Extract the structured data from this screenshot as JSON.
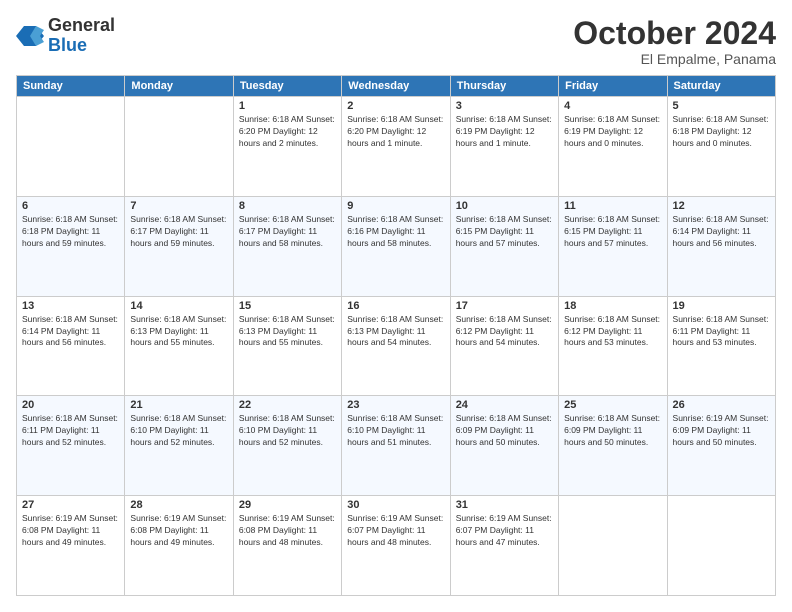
{
  "logo": {
    "general": "General",
    "blue": "Blue"
  },
  "header": {
    "month": "October 2024",
    "location": "El Empalme, Panama"
  },
  "days_of_week": [
    "Sunday",
    "Monday",
    "Tuesday",
    "Wednesday",
    "Thursday",
    "Friday",
    "Saturday"
  ],
  "weeks": [
    [
      {
        "day": "",
        "info": ""
      },
      {
        "day": "",
        "info": ""
      },
      {
        "day": "1",
        "info": "Sunrise: 6:18 AM\nSunset: 6:20 PM\nDaylight: 12 hours\nand 2 minutes."
      },
      {
        "day": "2",
        "info": "Sunrise: 6:18 AM\nSunset: 6:20 PM\nDaylight: 12 hours\nand 1 minute."
      },
      {
        "day": "3",
        "info": "Sunrise: 6:18 AM\nSunset: 6:19 PM\nDaylight: 12 hours\nand 1 minute."
      },
      {
        "day": "4",
        "info": "Sunrise: 6:18 AM\nSunset: 6:19 PM\nDaylight: 12 hours\nand 0 minutes."
      },
      {
        "day": "5",
        "info": "Sunrise: 6:18 AM\nSunset: 6:18 PM\nDaylight: 12 hours\nand 0 minutes."
      }
    ],
    [
      {
        "day": "6",
        "info": "Sunrise: 6:18 AM\nSunset: 6:18 PM\nDaylight: 11 hours\nand 59 minutes."
      },
      {
        "day": "7",
        "info": "Sunrise: 6:18 AM\nSunset: 6:17 PM\nDaylight: 11 hours\nand 59 minutes."
      },
      {
        "day": "8",
        "info": "Sunrise: 6:18 AM\nSunset: 6:17 PM\nDaylight: 11 hours\nand 58 minutes."
      },
      {
        "day": "9",
        "info": "Sunrise: 6:18 AM\nSunset: 6:16 PM\nDaylight: 11 hours\nand 58 minutes."
      },
      {
        "day": "10",
        "info": "Sunrise: 6:18 AM\nSunset: 6:15 PM\nDaylight: 11 hours\nand 57 minutes."
      },
      {
        "day": "11",
        "info": "Sunrise: 6:18 AM\nSunset: 6:15 PM\nDaylight: 11 hours\nand 57 minutes."
      },
      {
        "day": "12",
        "info": "Sunrise: 6:18 AM\nSunset: 6:14 PM\nDaylight: 11 hours\nand 56 minutes."
      }
    ],
    [
      {
        "day": "13",
        "info": "Sunrise: 6:18 AM\nSunset: 6:14 PM\nDaylight: 11 hours\nand 56 minutes."
      },
      {
        "day": "14",
        "info": "Sunrise: 6:18 AM\nSunset: 6:13 PM\nDaylight: 11 hours\nand 55 minutes."
      },
      {
        "day": "15",
        "info": "Sunrise: 6:18 AM\nSunset: 6:13 PM\nDaylight: 11 hours\nand 55 minutes."
      },
      {
        "day": "16",
        "info": "Sunrise: 6:18 AM\nSunset: 6:13 PM\nDaylight: 11 hours\nand 54 minutes."
      },
      {
        "day": "17",
        "info": "Sunrise: 6:18 AM\nSunset: 6:12 PM\nDaylight: 11 hours\nand 54 minutes."
      },
      {
        "day": "18",
        "info": "Sunrise: 6:18 AM\nSunset: 6:12 PM\nDaylight: 11 hours\nand 53 minutes."
      },
      {
        "day": "19",
        "info": "Sunrise: 6:18 AM\nSunset: 6:11 PM\nDaylight: 11 hours\nand 53 minutes."
      }
    ],
    [
      {
        "day": "20",
        "info": "Sunrise: 6:18 AM\nSunset: 6:11 PM\nDaylight: 11 hours\nand 52 minutes."
      },
      {
        "day": "21",
        "info": "Sunrise: 6:18 AM\nSunset: 6:10 PM\nDaylight: 11 hours\nand 52 minutes."
      },
      {
        "day": "22",
        "info": "Sunrise: 6:18 AM\nSunset: 6:10 PM\nDaylight: 11 hours\nand 52 minutes."
      },
      {
        "day": "23",
        "info": "Sunrise: 6:18 AM\nSunset: 6:10 PM\nDaylight: 11 hours\nand 51 minutes."
      },
      {
        "day": "24",
        "info": "Sunrise: 6:18 AM\nSunset: 6:09 PM\nDaylight: 11 hours\nand 50 minutes."
      },
      {
        "day": "25",
        "info": "Sunrise: 6:18 AM\nSunset: 6:09 PM\nDaylight: 11 hours\nand 50 minutes."
      },
      {
        "day": "26",
        "info": "Sunrise: 6:19 AM\nSunset: 6:09 PM\nDaylight: 11 hours\nand 50 minutes."
      }
    ],
    [
      {
        "day": "27",
        "info": "Sunrise: 6:19 AM\nSunset: 6:08 PM\nDaylight: 11 hours\nand 49 minutes."
      },
      {
        "day": "28",
        "info": "Sunrise: 6:19 AM\nSunset: 6:08 PM\nDaylight: 11 hours\nand 49 minutes."
      },
      {
        "day": "29",
        "info": "Sunrise: 6:19 AM\nSunset: 6:08 PM\nDaylight: 11 hours\nand 48 minutes."
      },
      {
        "day": "30",
        "info": "Sunrise: 6:19 AM\nSunset: 6:07 PM\nDaylight: 11 hours\nand 48 minutes."
      },
      {
        "day": "31",
        "info": "Sunrise: 6:19 AM\nSunset: 6:07 PM\nDaylight: 11 hours\nand 47 minutes."
      },
      {
        "day": "",
        "info": ""
      },
      {
        "day": "",
        "info": ""
      }
    ]
  ]
}
